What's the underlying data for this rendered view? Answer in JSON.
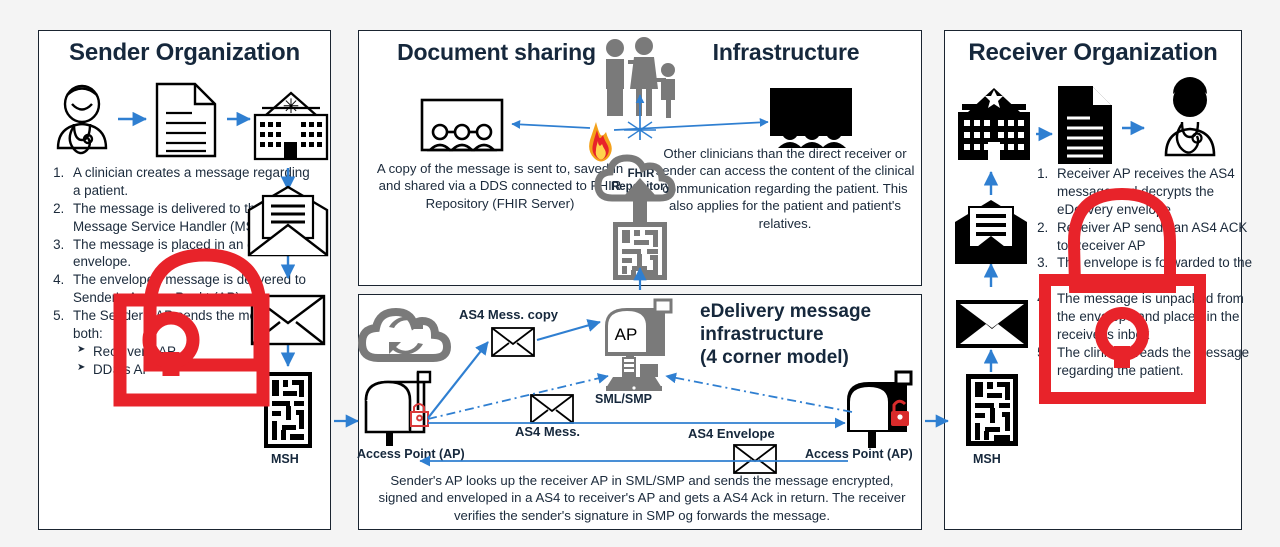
{
  "colors": {
    "background": "#f4f4f4",
    "panel_bg": "#ffffff",
    "panel_border": "#1a2430",
    "title": "#16283c",
    "arrow_blue": "#2f7fd1",
    "gray_icon": "#7a7a7a",
    "lock_red": "#e8232a",
    "black": "#000000"
  },
  "panels": {
    "sender": {
      "title": "Sender Organization",
      "steps": [
        "A clinician creates a message regarding a patient.",
        "The message is delivered to the Message Service Handler (MSH)",
        "The message is placed in an eDelivery envelope.",
        "The enveloped message is delivered to Sender's Access Punkt (AP).",
        "The Sender's AP sends the message to both:"
      ],
      "substeps": [
        "Receiver's AP",
        "DDS's AP"
      ],
      "icons": {
        "clinician": "clinician-icon",
        "document": "document-icon",
        "hospital": "hospital-icon",
        "open_envelope": "open-envelope-icon",
        "envelope": "envelope-icon",
        "msh": "msh-maze-icon"
      },
      "msh_label": "MSH"
    },
    "document_sharing": {
      "title": "Document sharing",
      "caption": "A copy of the message is sent to, saved in and shared via a DDS connected to FHIR Repository (FHIR Server)",
      "fhir_label": "FHIR Repository",
      "icons": {
        "screen_people": "screen-with-audience-icon",
        "flame": "fhir-flame-icon",
        "cloud": "cloud-repository-icon",
        "maze": "msh-maze-icon",
        "family": "family-icon"
      }
    },
    "infrastructure": {
      "title": "Infrastructure",
      "caption": "Other clinicians than the direct receiver or sender can access the content of the clinical  communication regarding the patient. This also applies for the patient and patient's relatives.",
      "icons": {
        "screen_people": "screen-with-audience-icon"
      }
    },
    "edelivery": {
      "title_lines": [
        "eDelivery message",
        "infrastructure",
        "(4 corner model)"
      ],
      "labels": {
        "as4_copy": "AS4 Mess. copy",
        "as4_mess": "AS4 Mess.",
        "as4_envelope": "AS4 Envelope",
        "ap_mailbox": "AP",
        "sml_smp": "SML/SMP",
        "access_point_left": "Access Point (AP)",
        "access_point_right": "Access Point (AP)"
      },
      "caption": "Sender's AP looks up the receiver AP in SML/SMP and sends the message encrypted, signed and enveloped in a AS4 to receiver's AP and gets a AS4 Ack in return. The receiver verifies the sender's signature in SMP og forwards the message.",
      "icons": {
        "cloud_sync": "cloud-sync-icon",
        "mailbox_locked": "mailbox-locked-icon",
        "mailbox_unlocked": "mailbox-unlocked-icon",
        "ap_mailbox": "mailbox-gray-icon",
        "server": "sml-smp-server-icon",
        "envelope": "envelope-icon"
      }
    },
    "receiver": {
      "title": "Receiver Organization",
      "steps": [
        "Receiver AP receives the AS4 message and decrypts the eDelivery envelope",
        "Receiver AP sends an AS4 ACK to Receiver AP",
        "The envelope is forwarded to the MSH",
        "The message is unpacked from the envelope and    placed in the receiver's inbox",
        "The clinician reads the message regarding the patient."
      ],
      "icons": {
        "hospital": "hospital-icon",
        "document": "document-icon",
        "clinician": "clinician-icon",
        "open_envelope": "open-envelope-icon",
        "envelope": "envelope-icon",
        "msh": "msh-maze-icon"
      },
      "msh_label": "MSH"
    }
  }
}
